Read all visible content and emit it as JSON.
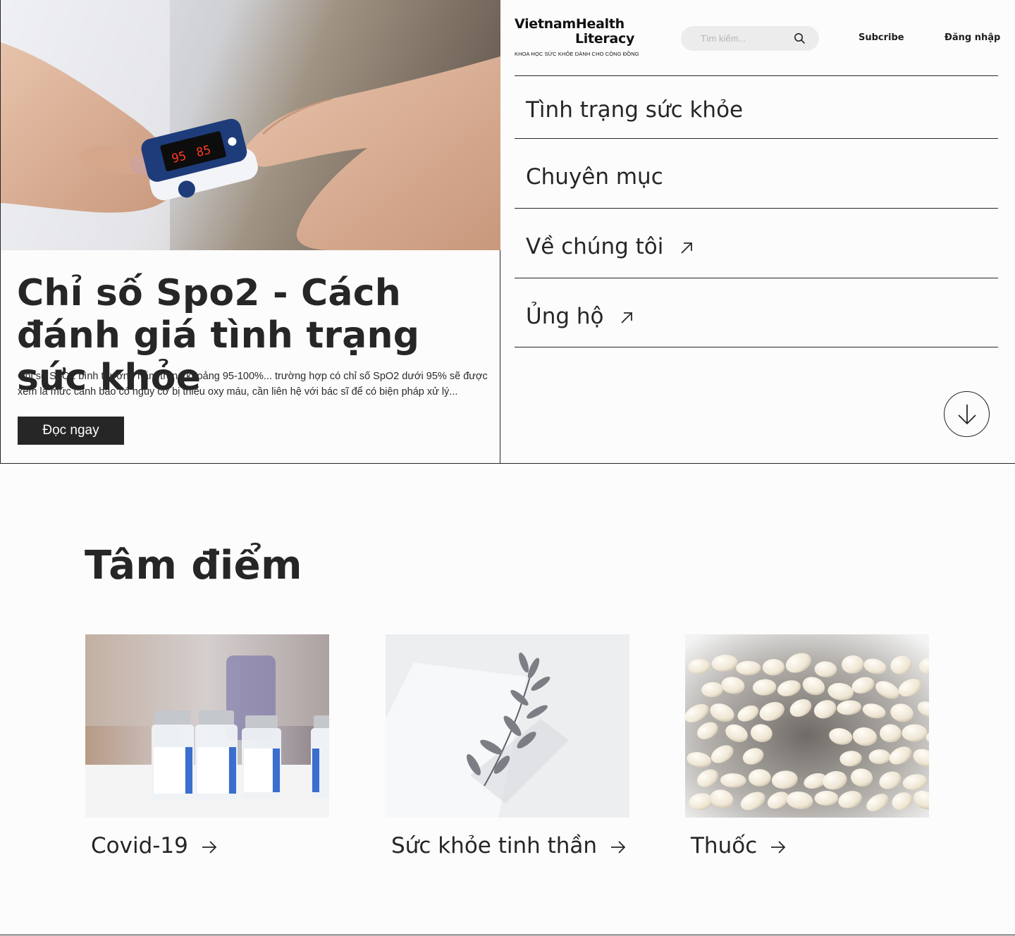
{
  "hero": {
    "image_alt": "hand-with-pulse-oximeter",
    "oximeter_reading_left": "95",
    "oximeter_reading_right": "85",
    "title": "Chỉ số Spo2 - Cách đánh giá tình trạng sức khỏe",
    "excerpt": "Chỉ số SpO2 bình thường nằm trong khoảng 95-100%...  trường hợp có chỉ số SpO2 dưới 95% sẽ được xem là mức cảnh báo có nguy cơ bị thiếu oxy máu, cần liên hệ với bác sĩ để có biện pháp xử lý...",
    "read_button": "Đọc ngay"
  },
  "header": {
    "logo_line1": "VietnamHealth",
    "logo_line2": "Literacy",
    "logo_tagline": "KHOA HỌC SỨC KHỎE DÀNH CHO CỘNG ĐỒNG",
    "search_placeholder": "Tìm kiếm...",
    "subscribe": "Subcribe",
    "login": "Đăng nhập"
  },
  "nav": {
    "items": [
      {
        "label": "Tình trạng sức khỏe",
        "external": false
      },
      {
        "label": "Chuyên mục",
        "external": false
      },
      {
        "label": "Về chúng tôi",
        "external": true
      },
      {
        "label": "Ủng hộ",
        "external": true
      }
    ]
  },
  "spotlight": {
    "title": "Tâm điểm",
    "cards": [
      {
        "label": "Covid-19",
        "image": "vaccine-vials"
      },
      {
        "label": "Sức khỏe tinh thần",
        "image": "plant-sprig"
      },
      {
        "label": "Thuốc",
        "image": "white-pills"
      }
    ]
  },
  "colors": {
    "text": "#262626",
    "button_bg": "#262626",
    "background": "#fcfcfc",
    "search_bg": "#ececec"
  }
}
